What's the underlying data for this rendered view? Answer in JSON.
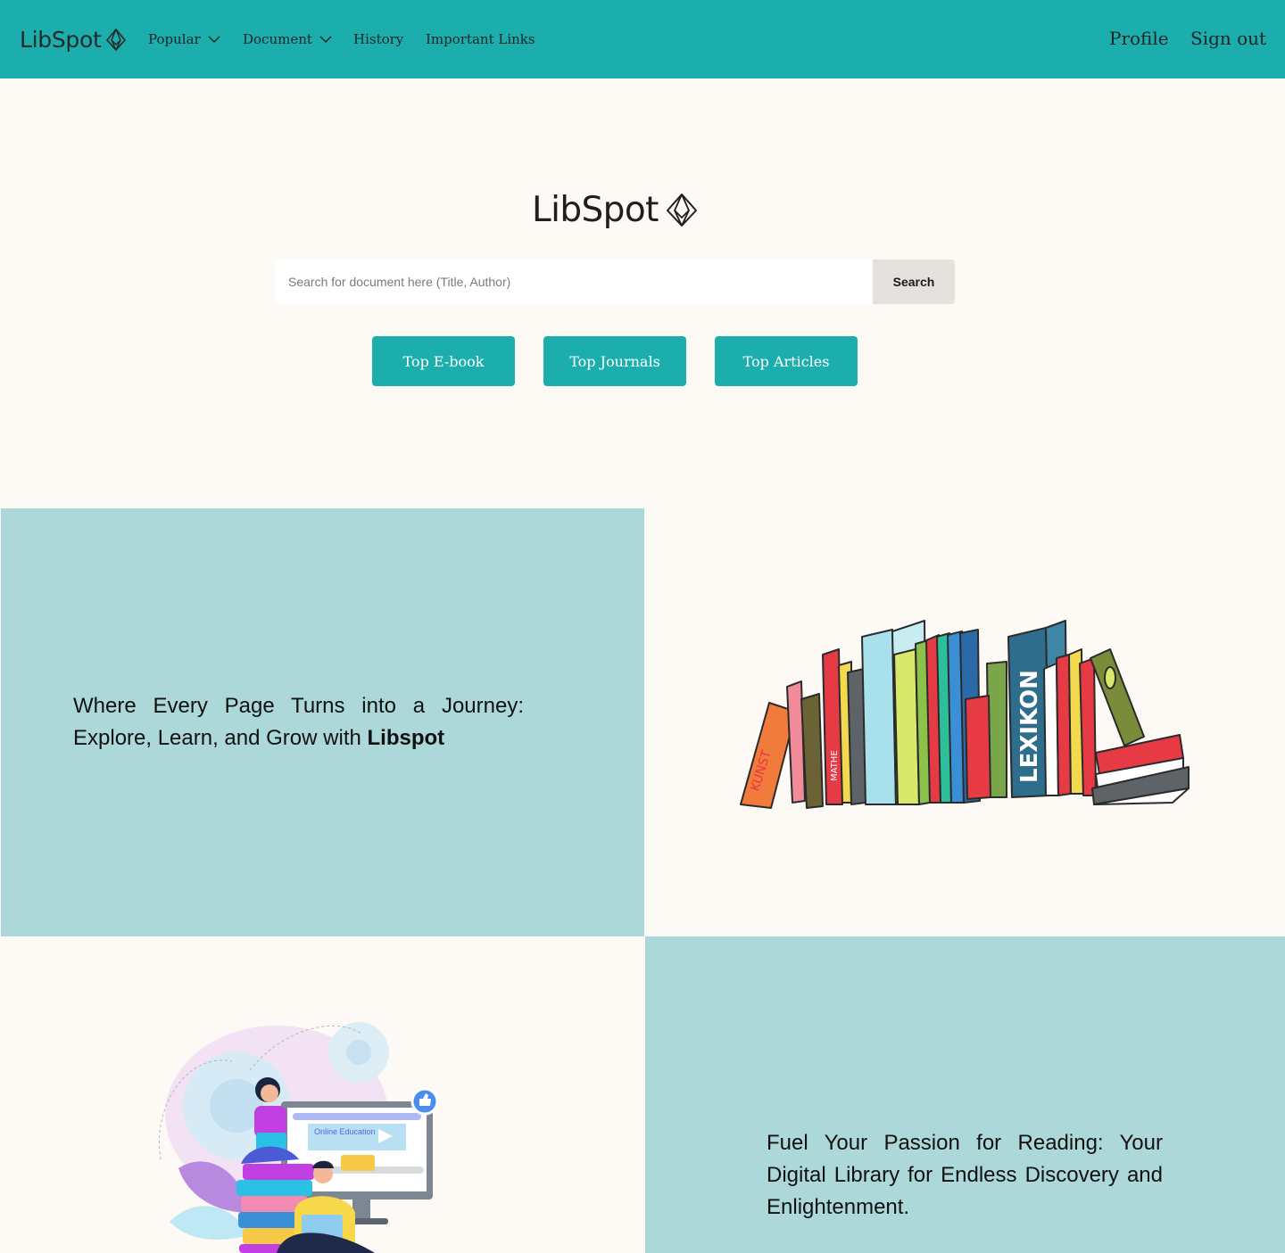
{
  "navbar": {
    "brand": "LibSpot",
    "items": [
      {
        "label": "Popular",
        "dropdown": true
      },
      {
        "label": "Document",
        "dropdown": true
      },
      {
        "label": "History",
        "dropdown": false
      },
      {
        "label": "Important Links",
        "dropdown": false
      }
    ],
    "profile_label": "Profile",
    "signout_label": "Sign out"
  },
  "hero": {
    "logo_text": "LibSpot",
    "search": {
      "placeholder": "Search for document here (Title, Author)",
      "value": "",
      "button_label": "Search"
    },
    "buttons": [
      {
        "label": "Top E-book"
      },
      {
        "label": "Top Journals"
      },
      {
        "label": "Top Articles"
      }
    ]
  },
  "feature_1": {
    "text_before": "Where Every Page Turns into a Journey: Explore, Learn, and Grow with ",
    "text_bold": "Libspot"
  },
  "feature_2": {
    "text": "Fuel Your Passion for Reading: Your Digital Library for Endless Discovery and Enlightenment.",
    "illustration_title": "Online Education"
  },
  "colors": {
    "primary": "#1cadad",
    "panel": "#acd8d9",
    "background": "#fdfaf5"
  },
  "icons": [
    "libspot-logo-icon",
    "chevron-down-icon",
    "thumbs-up-icon",
    "play-icon"
  ]
}
